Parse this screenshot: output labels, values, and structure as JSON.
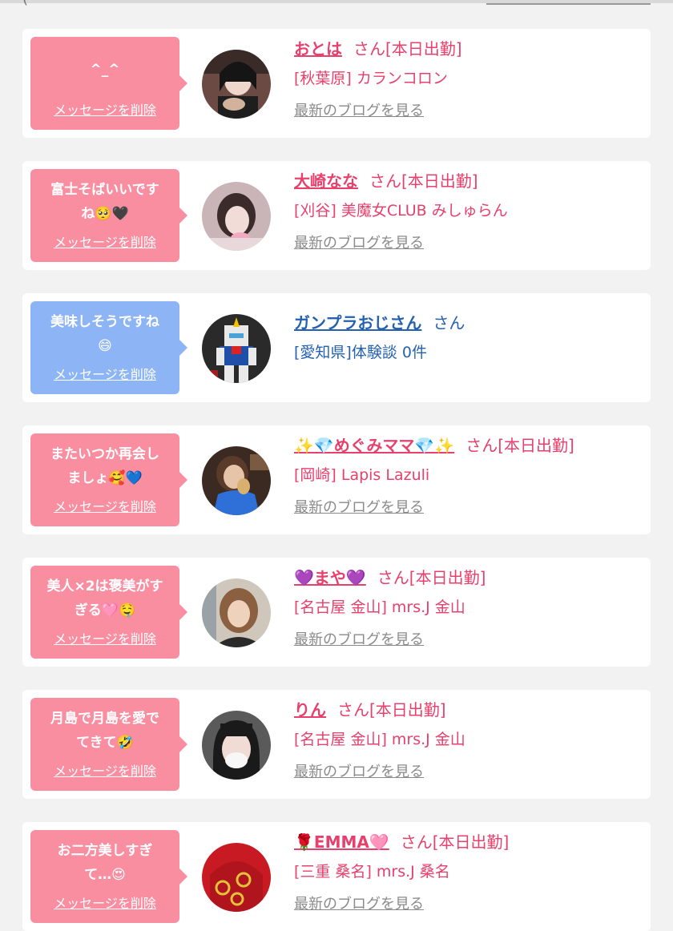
{
  "top_cut_text": "(",
  "cards": [
    {
      "type": "cast",
      "message": "^_^",
      "delete_label": "メッセージを削除",
      "name": "おとは",
      "suffix": "さん[本日出勤]",
      "shop": "[秋葉原] カランコロン",
      "blog_link": "最新のブログを見る",
      "bubble_color": "#fa8ea1"
    },
    {
      "type": "cast",
      "message": "富士そばいいです\nね🥺🖤",
      "delete_label": "メッセージを削除",
      "name": "大崎なな",
      "suffix": "さん[本日出勤]",
      "shop": "[刈谷] 美魔女CLUB みしゅらん",
      "blog_link": "最新のブログを見る",
      "bubble_color": "#fa8ea1"
    },
    {
      "type": "user",
      "message": "美味しそうですね\n😄",
      "delete_label": "メッセージを削除",
      "name": "ガンプラおじさん",
      "suffix": "さん",
      "shop": "[愛知県]体験談 0件",
      "bubble_color": "#8db5f5"
    },
    {
      "type": "cast",
      "message": "またいつか再会し\nましょ🥰💙",
      "delete_label": "メッセージを削除",
      "name": "✨💎めぐみママ💎✨",
      "suffix": "さん[本日出勤]",
      "shop": "[岡崎] Lapis Lazuli",
      "blog_link": "最新のブログを見る",
      "bubble_color": "#fa8ea1"
    },
    {
      "type": "cast",
      "message": "美人×2は褒美がす\nぎる🩷🤤",
      "delete_label": "メッセージを削除",
      "name": "💜まや💜",
      "suffix": "さん[本日出勤]",
      "shop": "[名古屋 金山] mrs.J 金山",
      "blog_link": "最新のブログを見る",
      "bubble_color": "#fa8ea1"
    },
    {
      "type": "cast",
      "message": "月島で月島を愛で\nてきて🤣",
      "delete_label": "メッセージを削除",
      "name": "りん",
      "suffix": "さん[本日出勤]",
      "shop": "[名古屋 金山] mrs.J 金山",
      "blog_link": "最新のブログを見る",
      "bubble_color": "#fa8ea1"
    },
    {
      "type": "cast",
      "message": "お二方美しすぎ\nて…😍",
      "delete_label": "メッセージを削除",
      "name": "🌹EMMA🩷",
      "suffix": "さん[本日出勤]",
      "shop": "[三重 桑名] mrs.J 桑名",
      "blog_link": "最新のブログを見る",
      "bubble_color": "#fa8ea1"
    }
  ]
}
